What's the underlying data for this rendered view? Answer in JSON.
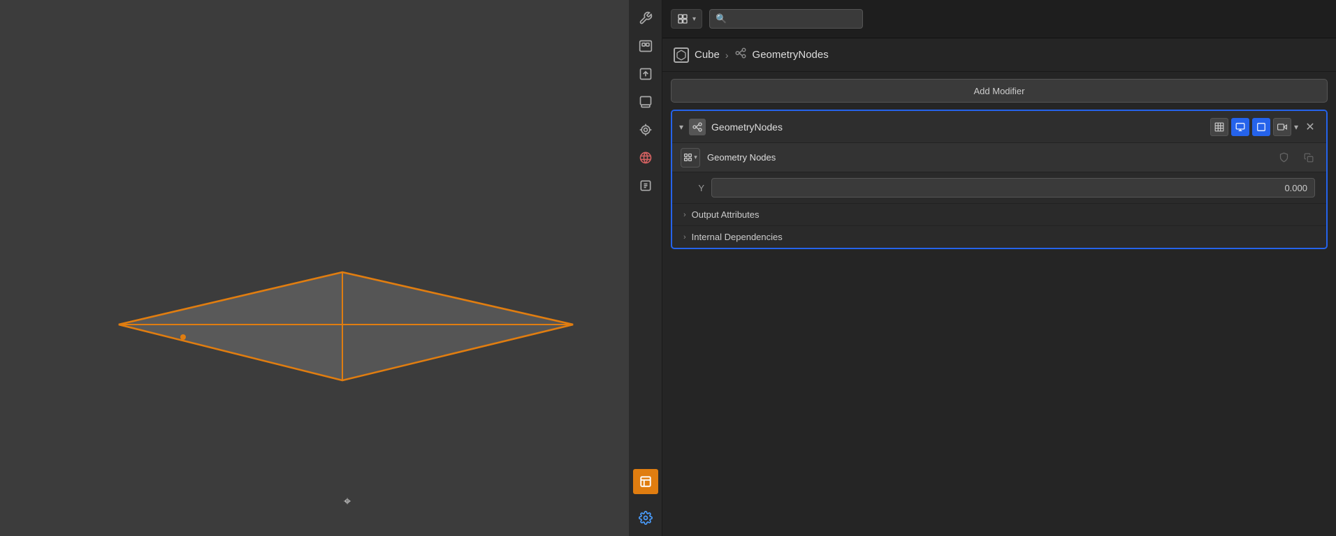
{
  "viewport": {
    "background_color": "#3c3c3c",
    "mesh_color": "#595959",
    "outline_color": "#e07d10"
  },
  "header": {
    "mode_button_label": "▾",
    "search_placeholder": "🔍"
  },
  "breadcrumb": {
    "object_icon": "▣",
    "object_name": "Cube",
    "arrow": "›",
    "nodes_icon": "⬡",
    "modifier_name": "GeometryNodes"
  },
  "add_modifier": {
    "label": "Add Modifier"
  },
  "modifier": {
    "chevron": "▾",
    "icon": "⬡",
    "name": "GeometryNodes",
    "toolbar": {
      "icon1": "⊞",
      "icon2": "⊟",
      "icon3": "⊠",
      "icon4": "📷",
      "dropdown": "▾",
      "close": "✕"
    },
    "node_tree": {
      "dropdown_icon": "▣▾",
      "name": "Geometry Nodes",
      "shield_icon": "🛡",
      "copy_icon": "⧉"
    },
    "fields": [
      {
        "label": "Y",
        "value": "0.000"
      }
    ],
    "sections": [
      {
        "label": "Output Attributes"
      },
      {
        "label": "Internal Dependencies"
      }
    ]
  },
  "side_toolbar": {
    "icons": [
      {
        "name": "wrench-icon",
        "symbol": "🔧",
        "active": false
      },
      {
        "name": "scene-icon",
        "symbol": "🎬",
        "active": false
      },
      {
        "name": "print-icon",
        "symbol": "🖨",
        "active": false
      },
      {
        "name": "image-icon",
        "symbol": "🖼",
        "active": false
      },
      {
        "name": "particles-icon",
        "symbol": "⦿",
        "active": false
      },
      {
        "name": "world-icon",
        "symbol": "🌐",
        "active": false
      },
      {
        "name": "render-icon",
        "symbol": "📷",
        "active": false
      },
      {
        "name": "material-icon",
        "symbol": "■",
        "active": true
      },
      {
        "name": "wrench2-icon",
        "symbol": "🔧",
        "active": false
      }
    ]
  }
}
